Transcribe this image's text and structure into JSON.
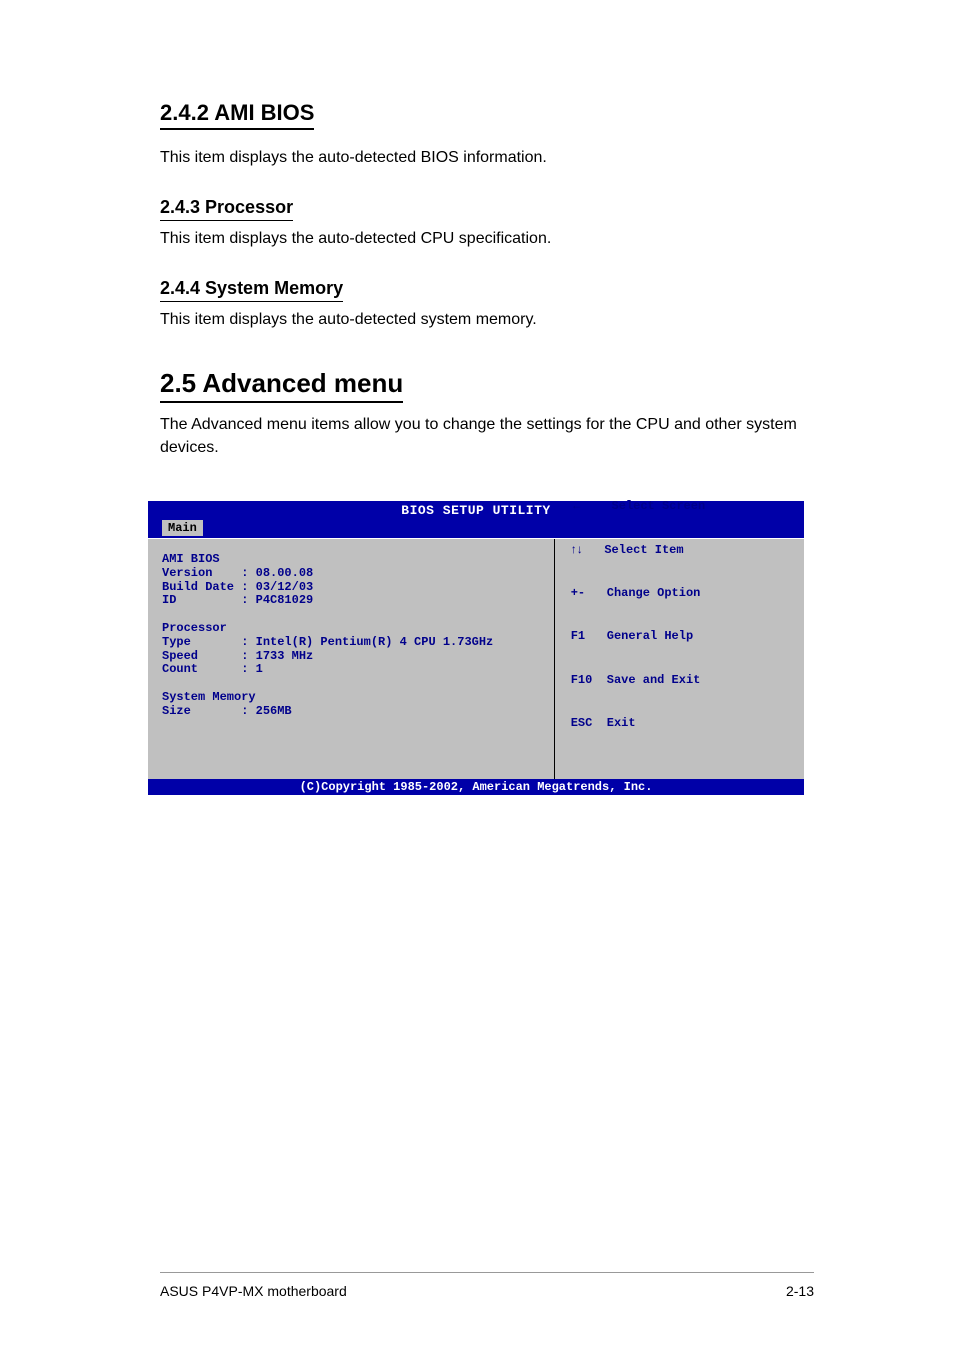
{
  "section_title": "2.4.2 AMI BIOS",
  "section_body": "This item displays the auto-detected BIOS information.",
  "processor_heading": "2.4.3 Processor",
  "processor_body": "This item displays the auto-detected CPU specification.",
  "memory_heading": "2.4.4 System Memory",
  "memory_body": "This item displays the auto-detected system memory.",
  "advanced_heading": "2.5 Advanced menu",
  "advanced_body": "The Advanced menu items allow you to change the settings for the CPU and other system devices.",
  "bios": {
    "title": "BIOS SETUP UTILITY",
    "tab": "Main",
    "left_text": "AMI BIOS\nVersion    : 08.00.08\nBuild Date : 03/12/03\nID         : P4C81029\n\nProcessor\nType       : Intel(R) Pentium(R) 4 CPU 1.73GHz\nSpeed      : 1733 MHz\nCount      : 1\n\nSystem Memory\nSize       : 256MB",
    "help": {
      "line1_key": "←",
      "line1_txt": "Select Screen",
      "line2_key": "↑↓",
      "line2_txt": "Select Item",
      "line3_key": "+-",
      "line3_txt": "Change Option",
      "line4_key": "F1",
      "line4_txt": "General Help",
      "line5_key": "F10",
      "line5_txt": "Save and Exit",
      "line6_key": "ESC",
      "line6_txt": "Exit"
    },
    "footer": "(C)Copyright 1985-2002, American Megatrends, Inc."
  },
  "page_footer_left": "ASUS P4VP-MX motherboard",
  "page_footer_right": "2-13"
}
